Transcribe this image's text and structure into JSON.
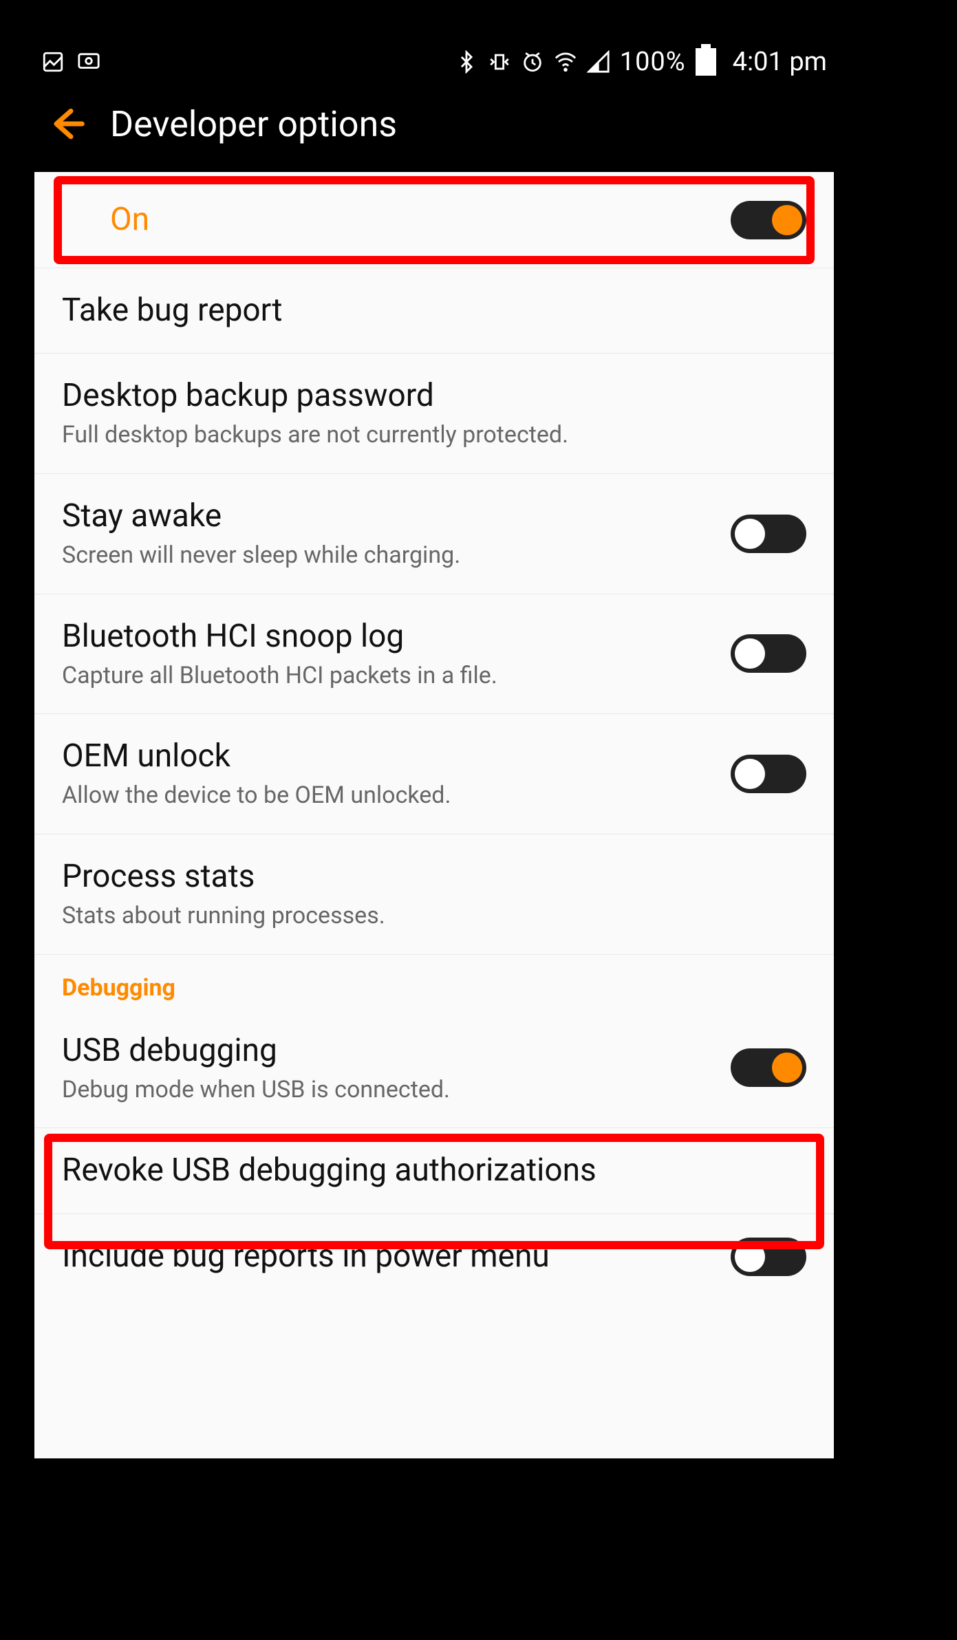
{
  "status": {
    "battery_pct": "100%",
    "time": "4:01 pm"
  },
  "header": {
    "title": "Developer options"
  },
  "main_toggle": {
    "label": "On",
    "on": true
  },
  "items": [
    {
      "title": "Take bug report",
      "sub": null,
      "has_switch": false
    },
    {
      "title": "Desktop backup password",
      "sub": "Full desktop backups are not currently protected.",
      "has_switch": false
    },
    {
      "title": "Stay awake",
      "sub": "Screen will never sleep while charging.",
      "has_switch": true,
      "on": false
    },
    {
      "title": "Bluetooth HCI snoop log",
      "sub": "Capture all Bluetooth HCI packets in a file.",
      "has_switch": true,
      "on": false
    },
    {
      "title": "OEM unlock",
      "sub": "Allow the device to be OEM unlocked.",
      "has_switch": true,
      "on": false
    },
    {
      "title": "Process stats",
      "sub": "Stats about running processes.",
      "has_switch": false
    }
  ],
  "section": {
    "label": "Debugging"
  },
  "debug_items": [
    {
      "title": "USB debugging",
      "sub": "Debug mode when USB is connected.",
      "has_switch": true,
      "on": true
    },
    {
      "title": "Revoke USB debugging authorizations",
      "sub": null,
      "has_switch": false
    },
    {
      "title": "Include bug reports in power menu",
      "sub": null,
      "has_switch": true,
      "on": false
    }
  ]
}
